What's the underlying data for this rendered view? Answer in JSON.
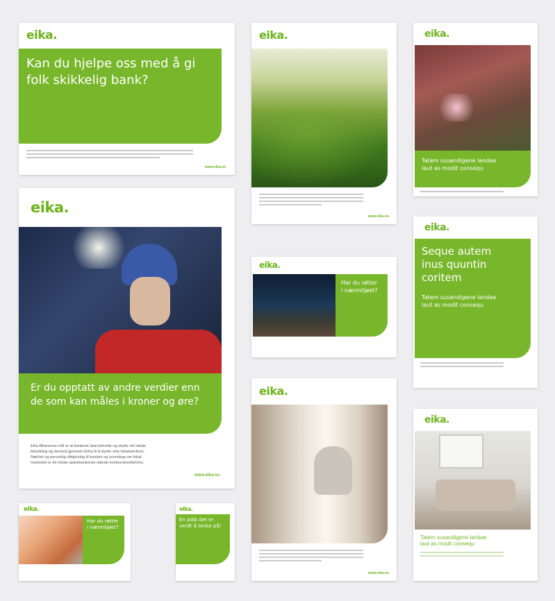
{
  "brand": {
    "logo": "eika.",
    "accent": "#78b72b",
    "logo_color": "#6cb31d"
  },
  "cards": {
    "c1": {
      "headline_1": "Kan du hjelpe oss med å gi",
      "headline_2": "folk skikkelig bank?",
      "url": "www.eika.no"
    },
    "c2": {
      "url": "www.eika.no"
    },
    "c3": {
      "subhead_1": "Tatem susandigene landae",
      "subhead_2": "laut as modit consequ"
    },
    "c4": {
      "headline_1": "Er du opptatt av andre verdier enn",
      "headline_2": "de som kan måles i kroner og øre?",
      "body_1": "Eika Alliansens mål er at bankene skal beholde og styrke sin lokale",
      "body_2": "betydning og dermed gjennom bidra til å styrke sine lokalsamfunn.",
      "body_3": "Nærhet og personlig rådgivning til kunden og kunnskap om lokal-",
      "body_4": "markedet er de lokale sparebankenes største konkurransefortrinn.",
      "url": "www.eika.no"
    },
    "c5": {
      "headline_1": "Har du røtter",
      "headline_2": "i nærmiljøet?"
    },
    "c6": {
      "headline_1": "Seque autem",
      "headline_2": "inus quuntin",
      "headline_3": "coritem",
      "subhead_1": "Tatem susandigene landae",
      "subhead_2": "laut as modit consequ"
    },
    "c7": {
      "url": "www.eika.no"
    },
    "c8": {
      "subhead_1": "Tatem susandigene landae",
      "subhead_2": "laut as modit consequ"
    },
    "c9": {
      "headline_1": "Har du røtter",
      "headline_2": "i nærmiljøet?"
    },
    "c10": {
      "headline_1": "En jobb det er",
      "headline_2": "verdt å tenke på!"
    }
  }
}
